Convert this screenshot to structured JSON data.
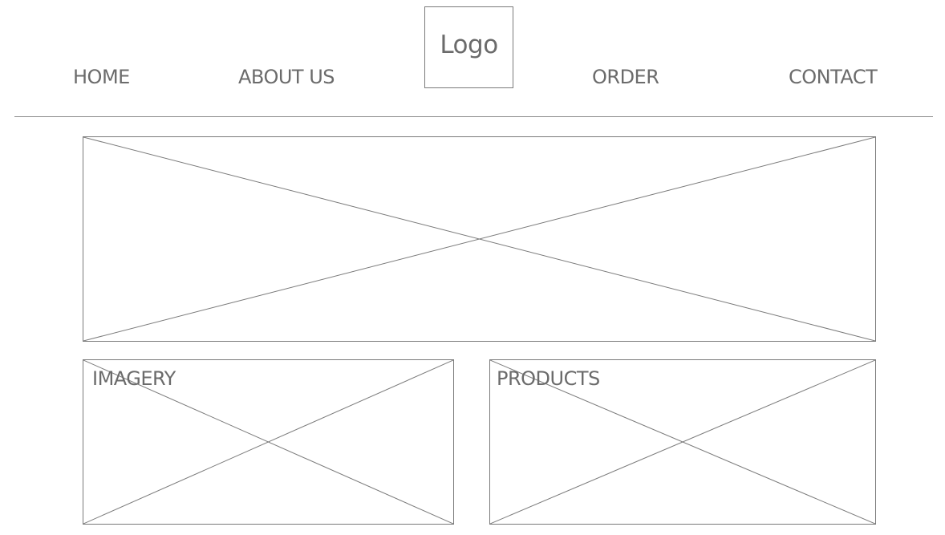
{
  "nav": {
    "items": [
      {
        "label": "HOME"
      },
      {
        "label": "ABOUT US"
      },
      {
        "label": "ORDER"
      },
      {
        "label": "CONTACT"
      }
    ]
  },
  "logo": {
    "text": "Logo"
  },
  "sections": {
    "imagery": {
      "label": "IMAGERY"
    },
    "products": {
      "label": "PRODUCTS"
    }
  },
  "colors": {
    "text": "#6b6b6b",
    "border": "#7a7a7a",
    "background": "#ffffff"
  }
}
